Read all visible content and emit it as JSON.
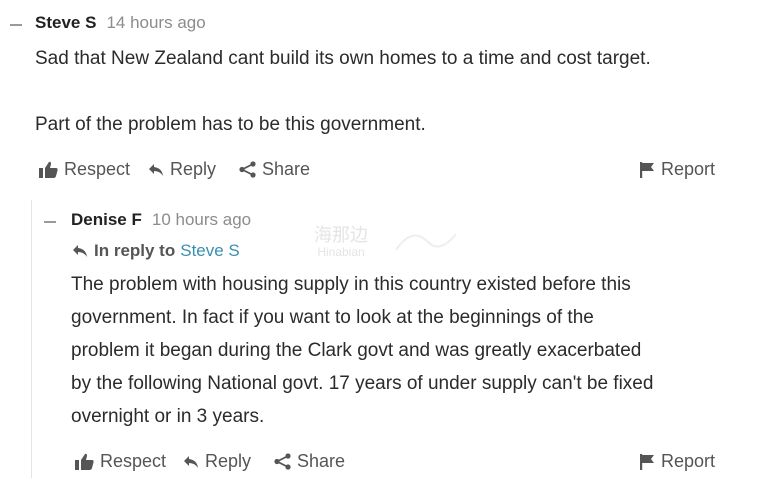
{
  "comments": [
    {
      "author": "Steve S",
      "timestamp": "14 hours ago",
      "body": [
        "Sad that New Zealand cant build its own homes to a time and cost target.",
        "",
        "Part of the problem has to be this government."
      ],
      "actions": {
        "respect": "Respect",
        "reply": "Reply",
        "share": "Share",
        "report": "Report"
      }
    },
    {
      "author": "Denise F",
      "timestamp": "10 hours ago",
      "reply_to_label": "In reply to",
      "reply_to_name": "Steve S",
      "body": [
        "The problem with housing supply in this country existed before this",
        "government. In fact if you want to look at the beginnings of the",
        "problem it began during the Clark govt and was greatly exacerbated",
        "by the following National govt. 17 years of under supply can't be fixed",
        "overnight or in 3 years."
      ],
      "actions": {
        "respect": "Respect",
        "reply": "Reply",
        "share": "Share",
        "report": "Report"
      }
    }
  ],
  "watermark": {
    "line1": "海那边",
    "line2": "Hinabian"
  },
  "colors": {
    "link": "#3a8fb0",
    "muted": "#8c8c8c",
    "action": "#555555"
  }
}
